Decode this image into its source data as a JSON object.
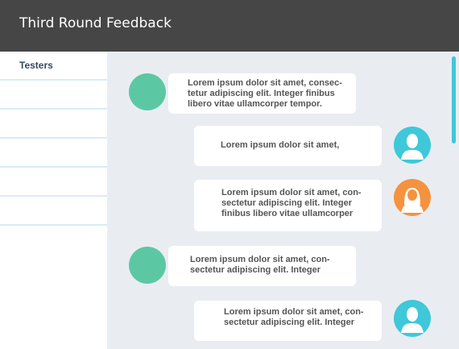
{
  "window": {
    "title": "Third Round Feedback"
  },
  "sidebar": {
    "heading": "Testers",
    "rows": 5
  },
  "messages": [
    {
      "side": "left",
      "avatar": "green",
      "text": "Lorem ipsum dolor sit amet, consec-\ntetur adipiscing elit. Integer finibus\nlibero vitae ullamcorper tempor."
    },
    {
      "side": "right",
      "avatar": "teal",
      "text": "Lorem ipsum dolor sit amet,"
    },
    {
      "side": "right",
      "avatar": "orange",
      "text": "Lorem ipsum dolor sit amet, con-\nsectetur adipiscing elit. Integer\nfinibus libero vitae ullamcorper"
    },
    {
      "side": "left",
      "avatar": "green",
      "text": "Lorem ipsum dolor sit amet, con-\nsectetur adipiscing elit. Integer"
    },
    {
      "side": "right",
      "avatar": "teal",
      "text": "Lorem ipsum dolor sit amet, con-\nsectetur adipiscing elit. Integer"
    }
  ],
  "icons": {
    "male_avatar": "male-user-icon",
    "female_avatar": "female-user-icon"
  },
  "colors": {
    "header": "#464646",
    "accent": "#3fc8d9",
    "green": "#5cc8a3",
    "orange": "#f5923f"
  }
}
